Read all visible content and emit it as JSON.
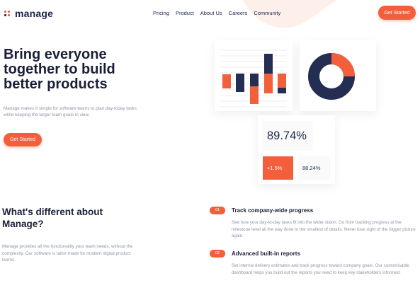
{
  "brand": {
    "name": "manage",
    "accent": "#f25f3a",
    "navy": "#242d52",
    "logo_icon": "four-dot-logo-icon"
  },
  "nav": {
    "items": [
      "Pricing",
      "Product",
      "About Us",
      "Careers",
      "Community"
    ],
    "cta": "Get Started"
  },
  "hero": {
    "title": "Bring everyone together to build better products",
    "text": "Manage makes it simple for software teams to plan day-today tasks while keeping the larger team goals in view.",
    "cta": "Get Started"
  },
  "dashboard": {
    "stat_main": "89.74%",
    "stat_change": "+1.5%",
    "stat_secondary": "88.24%",
    "donut_share_orange": 0.25
  },
  "features": {
    "title": "What's different about Manage?",
    "text": "Manage provides all the functionality your team needs, without the complexity. Our software is tailor-made for modern digital product teams.",
    "items": [
      {
        "num": "01",
        "title": "Track company-wide progress",
        "desc": "See how your day-to-day tasks fit into the wider vision. Go from tracking progress at the milestone level all the way done to the smallest of details. Never lose sight of the bigger picture again."
      },
      {
        "num": "02",
        "title": "Advanced built-in reports",
        "desc": "Set internal delivery estimates and track progress toward company goals. Our customisable dashboard helps you build out the reports you need to keep key stakeholders informed."
      }
    ]
  }
}
